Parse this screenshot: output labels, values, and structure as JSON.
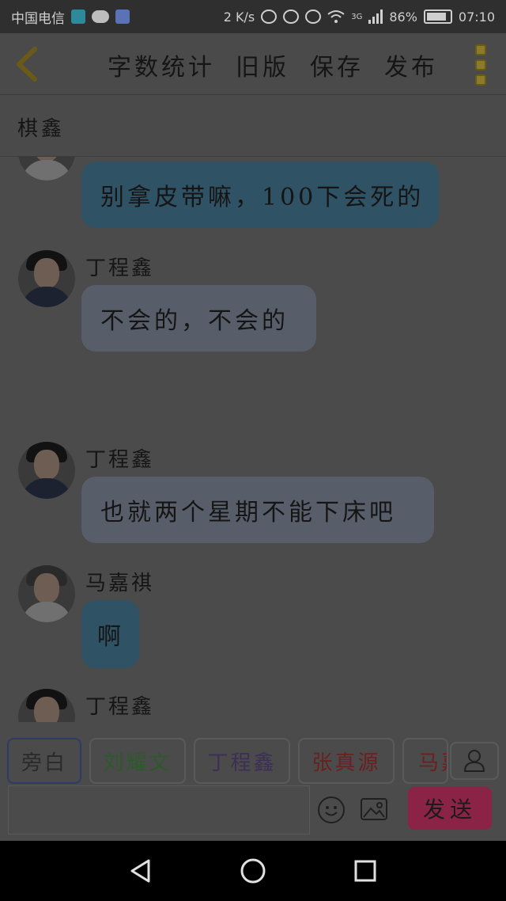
{
  "status_bar": {
    "carrier": "中国电信",
    "speed": "2 K/s",
    "network": "3G",
    "battery": "86%",
    "time": "07:10",
    "icons": [
      "shield-icon",
      "wechat-icon",
      "app-icon",
      "headset-icon",
      "alarm-icon",
      "eye-icon",
      "wifi-icon",
      "signal-icon",
      "battery-icon"
    ]
  },
  "header": {
    "back_icon": "chevron-left-icon",
    "actions": {
      "word_count": "字数统计",
      "old_version": "旧版",
      "save": "保存",
      "publish": "发布"
    },
    "more_icon": "vertical-dots-icon"
  },
  "title": "棋鑫",
  "messages": [
    {
      "sender": "",
      "text": "别拿皮带嘛，100下会死的",
      "bubble_color": "#2f5264",
      "avatar": "light"
    },
    {
      "sender": "丁程鑫",
      "text": "不会的，不会的",
      "bubble_color": "#575e6a",
      "avatar": "dark"
    },
    {
      "sender": "丁程鑫",
      "text": "也就两个星期不能下床吧",
      "bubble_color": "#575e6a",
      "avatar": "dark"
    },
    {
      "sender": "马嘉祺",
      "text": "啊",
      "bubble_color": "#2f5264",
      "avatar": "light"
    },
    {
      "sender": "丁程鑫",
      "text": "",
      "bubble_color": "#575e6a",
      "avatar": "dark"
    }
  ],
  "characters": [
    {
      "name": "旁白",
      "color": "#2a2a2a",
      "active": true
    },
    {
      "name": "刘耀文",
      "color": "#2c5a2a",
      "active": false
    },
    {
      "name": "丁程鑫",
      "color": "#3c2f55",
      "active": false
    },
    {
      "name": "张真源",
      "color": "#6a2020",
      "active": false
    },
    {
      "name": "马嘉祺",
      "color": "#6a2020",
      "active": false
    }
  ],
  "input": {
    "placeholder": "",
    "send_label": "发送",
    "send_color": "#8b2347"
  },
  "nav": {
    "back": "back-triangle-icon",
    "home": "home-circle-icon",
    "recents": "recents-square-icon"
  }
}
